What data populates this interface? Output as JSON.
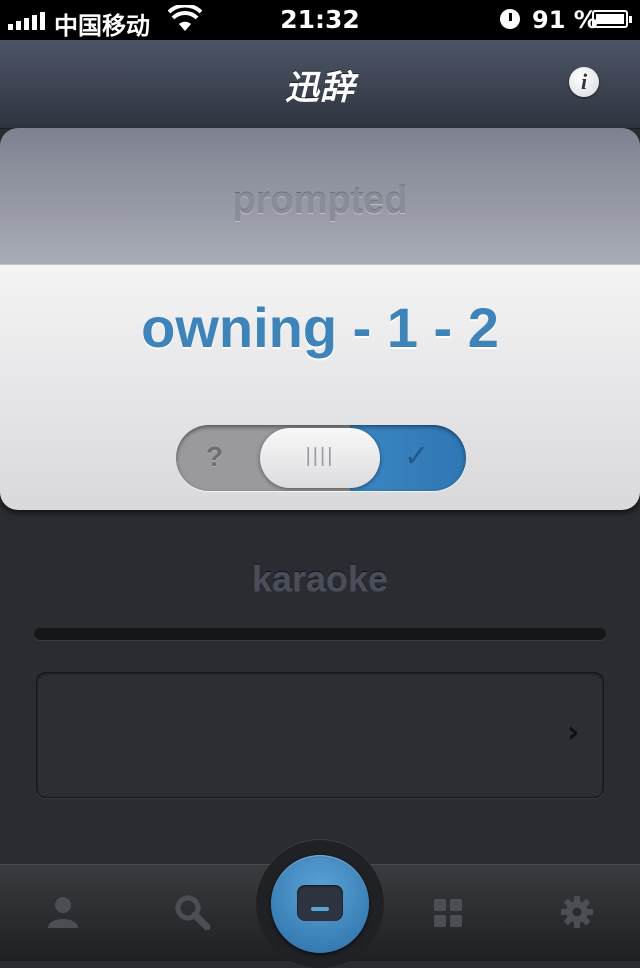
{
  "status_bar": {
    "carrier": "中国移动",
    "time": "21:32",
    "battery_percent": "91 %"
  },
  "nav": {
    "title": "迅辞",
    "info_label": "i"
  },
  "card": {
    "prompt_label": "prompted",
    "word": "owning - 1 - 2",
    "toggle": {
      "left_label": "?",
      "grip_label": "||||",
      "right_label": "✓"
    }
  },
  "secondary_word": "karaoke",
  "progress": {
    "value": 0.0
  },
  "detail": {
    "chevron": "›"
  },
  "tabs": [
    {
      "icon": "profile-icon"
    },
    {
      "icon": "search-icon"
    },
    {
      "icon": "flashcard-icon"
    },
    {
      "icon": "grid-icon"
    },
    {
      "icon": "gear-icon"
    }
  ],
  "colors": {
    "accent": "#3f84b8",
    "card_top": "#9a9da8",
    "card_bottom": "#ececee",
    "background": "#2a2c31"
  }
}
